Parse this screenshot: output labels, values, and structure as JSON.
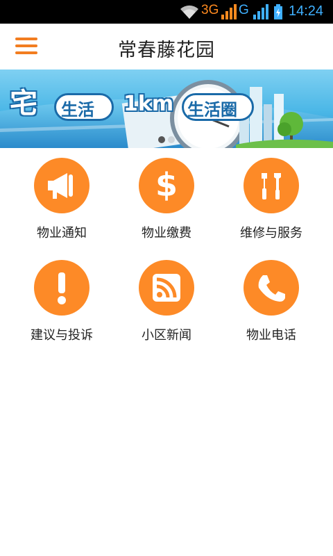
{
  "status_bar": {
    "network_1": "3G",
    "network_2": "G",
    "time": "14:24",
    "icons": [
      "wifi-icon",
      "signal-icon",
      "signal-icon",
      "battery-charging-icon"
    ]
  },
  "header": {
    "title": "常春藤花园",
    "menu_icon": "hamburger-menu-icon",
    "accent_color": "#f27d20"
  },
  "banner": {
    "text_1": "宅",
    "text_2": "生活",
    "text_3": "1km",
    "text_4": "生活圈",
    "dots_total": 2,
    "dot_active": 1
  },
  "grid": {
    "items": [
      {
        "label": "物业通知",
        "icon": "megaphone-icon"
      },
      {
        "label": "物业缴费",
        "icon": "dollar-icon"
      },
      {
        "label": "维修与服务",
        "icon": "tools-icon"
      },
      {
        "label": "建议与投诉",
        "icon": "exclamation-icon"
      },
      {
        "label": "小区新闻",
        "icon": "rss-icon"
      },
      {
        "label": "物业电话",
        "icon": "phone-icon"
      }
    ],
    "circle_color": "#fd8a27"
  }
}
